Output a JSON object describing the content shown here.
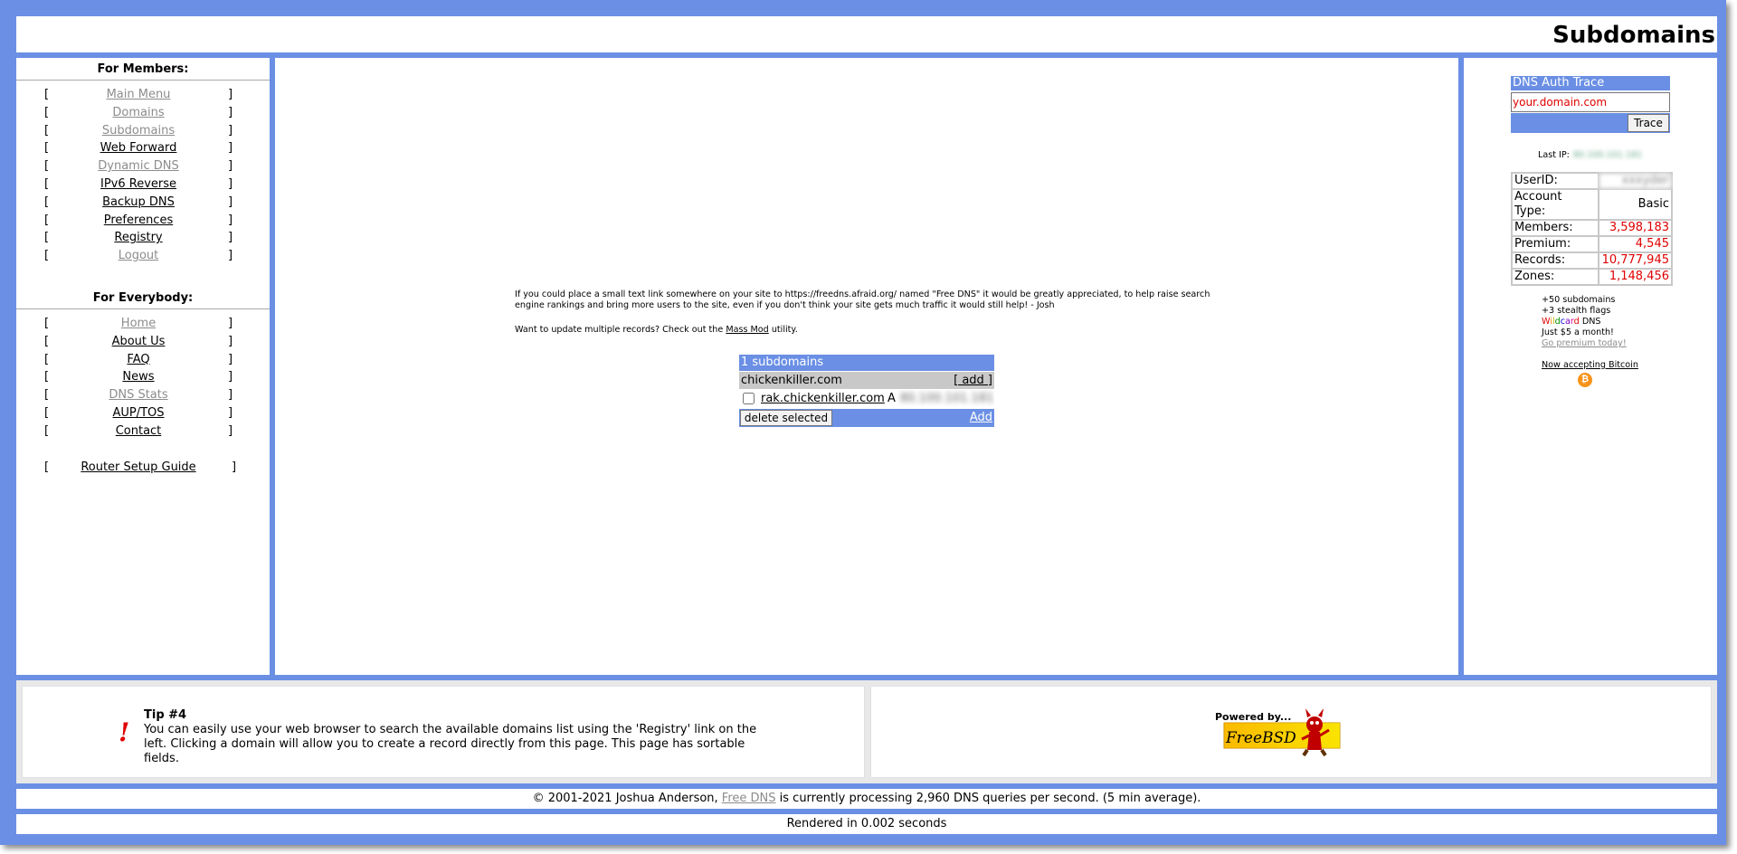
{
  "header": {
    "title": "Subdomains"
  },
  "colors": {
    "frame": "#6a8fe4",
    "accent_red": "#e00000",
    "muted_link": "#8c8c8c"
  },
  "leftnav": {
    "members_heading": "For Members:",
    "members": [
      {
        "label": "Main Menu",
        "state": "inactive"
      },
      {
        "label": "Domains",
        "state": "inactive"
      },
      {
        "label": "Subdomains",
        "state": "inactive"
      },
      {
        "label": "Web Forward",
        "state": "active"
      },
      {
        "label": "Dynamic DNS",
        "state": "inactive"
      },
      {
        "label": "IPv6 Reverse",
        "state": "active"
      },
      {
        "label": "Backup DNS",
        "state": "active"
      },
      {
        "label": "Preferences",
        "state": "active"
      },
      {
        "label": "Registry",
        "state": "active"
      },
      {
        "label": "Logout",
        "state": "inactive"
      }
    ],
    "everybody_heading": "For Everybody:",
    "everybody": [
      {
        "label": "Home",
        "state": "inactive"
      },
      {
        "label": "About Us",
        "state": "active"
      },
      {
        "label": "FAQ",
        "state": "active"
      },
      {
        "label": "News",
        "state": "active"
      },
      {
        "label": "DNS Stats",
        "state": "inactive"
      },
      {
        "label": "AUP/TOS",
        "state": "active"
      },
      {
        "label": "Contact",
        "state": "active"
      }
    ],
    "router_guide": "Router Setup Guide",
    "bracket_left": "[",
    "bracket_right": "]"
  },
  "main": {
    "appreciate_text": "If you could place a small text link somewhere on your site to https://freedns.afraid.org/ named \"Free DNS\" it would be greatly appreciated, to help raise search engine rankings and bring more users to the site, even if you don't think your site gets much traffic it would still help! - Josh",
    "massmod_prefix": "Want to update multiple records? Check out the ",
    "massmod_link": "Mass Mod",
    "massmod_suffix": " utility.",
    "subdomains": {
      "count_label": "1 subdomains",
      "domain": "chickenkiller.com",
      "add_link": "[ add ]",
      "record": {
        "name": "rak.chickenkiller.com",
        "type": "A",
        "value": "80.100.101.181"
      },
      "delete_button": "delete selected",
      "add_bottom": "Add"
    }
  },
  "right": {
    "trace_heading": "DNS Auth Trace",
    "trace_input_value": "your.domain.com",
    "trace_button": "Trace",
    "last_ip_label": "Last IP:",
    "last_ip_value": "80.100.101.181",
    "stats": [
      {
        "label": "UserID:",
        "value": "xxxyder",
        "style": "blur"
      },
      {
        "label": "Account Type:",
        "value": "Basic",
        "style": "plain"
      },
      {
        "label": "Members:",
        "value": "3,598,183",
        "style": "red"
      },
      {
        "label": "Premium:",
        "value": "4,545",
        "style": "red"
      },
      {
        "label": "Records:",
        "value": "10,777,945",
        "style": "red"
      },
      {
        "label": "Zones:",
        "value": "1,148,456",
        "style": "red"
      }
    ],
    "promo_lines": [
      "+50 subdomains",
      "+3 stealth flags"
    ],
    "wildcard_word": "Wildcard",
    "wildcard_suffix": " DNS",
    "promo_price": "Just $5 a month!",
    "go_premium": "Go premium today!",
    "bitcoin_text": "Now accepting Bitcoin",
    "bitcoin_icon": "bitcoin-icon"
  },
  "tip": {
    "title": "Tip #4",
    "text": "You can easily use your web browser to search the available domains list using the 'Registry' link on the left. Clicking a domain will allow you to create a record directly from this page. This page has sortable fields.",
    "icon": "exclamation-icon"
  },
  "freebsd": {
    "powered_by": "Powered by...",
    "name": "FreeBSD"
  },
  "footer": {
    "copyright_prefix": "© 2001-2021 Joshua Anderson, ",
    "copyright_link": "Free DNS",
    "copyright_suffix": " is currently processing 2,960 DNS queries per second. (5 min average).",
    "rendered": "Rendered in 0.002 seconds"
  }
}
